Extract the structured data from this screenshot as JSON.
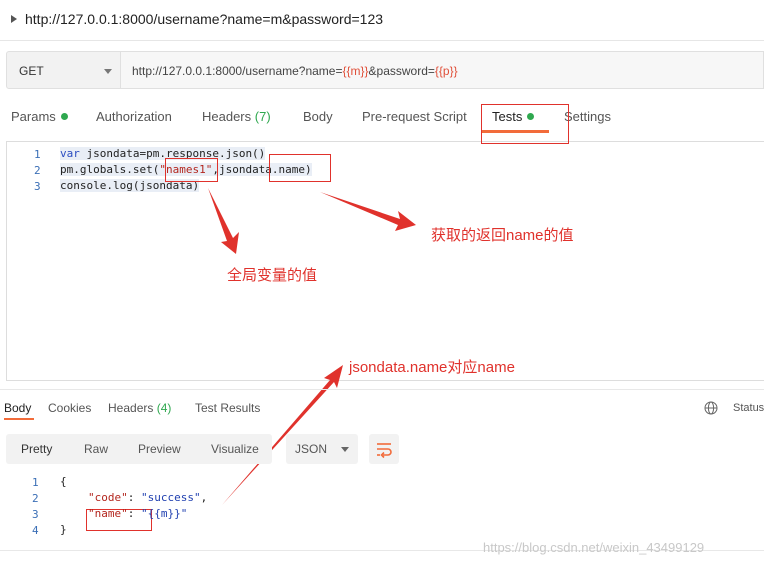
{
  "title": "http://127.0.0.1:8000/username?name=m&password=123",
  "request": {
    "method": "GET",
    "url_base": "http://127.0.0.1:8000/username?name=",
    "url_var1": "{{m}}",
    "url_mid": "&password=",
    "url_var2": "{{p}}"
  },
  "request_tabs": {
    "params": "Params",
    "authorization": "Authorization",
    "headers": "Headers",
    "headers_count": "(7)",
    "body": "Body",
    "prerequest": "Pre-request Script",
    "tests": "Tests",
    "settings": "Settings"
  },
  "editor": {
    "line_numbers": [
      "1",
      "2",
      "3"
    ],
    "line1_kw": "var",
    "line1_rest": " jsondata=pm.response.json()",
    "line2_a": "pm.globals.set(",
    "line2_str": "\"names1\"",
    "line2_b": ",jsondata.name)",
    "line3": "console.log(jsondata)"
  },
  "annotations": {
    "return_name": "获取的返回name的值",
    "global_value": "全局变量的值",
    "jsondata_name": "jsondata.name对应name"
  },
  "response_tabs": {
    "body": "Body",
    "cookies": "Cookies",
    "headers": "Headers",
    "headers_count": "(4)",
    "test_results": "Test Results",
    "status": "Status"
  },
  "format": {
    "pretty": "Pretty",
    "raw": "Raw",
    "preview": "Preview",
    "visualize": "Visualize",
    "json": "JSON"
  },
  "response_body": {
    "line_numbers": [
      "1",
      "2",
      "3",
      "4"
    ],
    "open": "{",
    "k1": "\"code\"",
    "v1": "\"success\"",
    "k2": "\"name\"",
    "v2": "\"{{m}}\"",
    "close": "}"
  },
  "watermark": "https://blog.csdn.net/weixin_43499129",
  "colors": {
    "accent": "#f26b3a",
    "annotation": "#e0322c",
    "active_dot": "#2fa84f"
  }
}
